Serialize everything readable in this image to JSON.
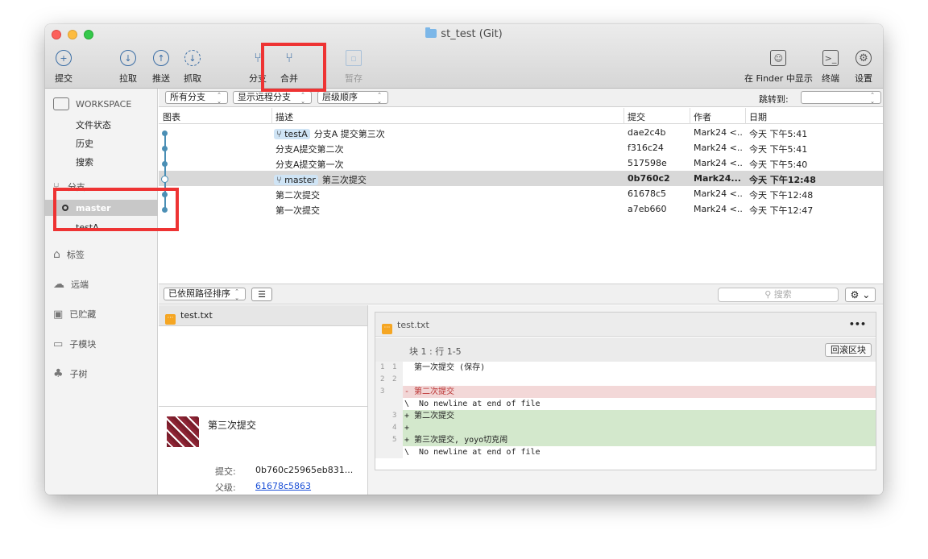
{
  "window": {
    "title": "st_test (Git)"
  },
  "toolbar": {
    "commit": "提交",
    "pull": "拉取",
    "push": "推送",
    "fetch": "抓取",
    "branch": "分支",
    "merge": "合并",
    "stash": "暂存",
    "show_in_finder": "在 Finder 中显示",
    "terminal": "终端",
    "settings": "设置"
  },
  "sidebar": {
    "workspace_title": "WORKSPACE",
    "workspace_items": [
      "文件状态",
      "历史",
      "搜索"
    ],
    "branches_title": "分支",
    "branches": [
      "master",
      "testA"
    ],
    "tags_title": "标签",
    "remotes_title": "远端",
    "stashes_title": "已贮藏",
    "submodules_title": "子模块",
    "subtrees_title": "子树"
  },
  "filterbar": {
    "branch_filter": "所有分支",
    "remote_filter": "显示远程分支",
    "order": "层级顺序",
    "jump_label": "跳转到:"
  },
  "columns": {
    "graph": "图表",
    "description": "描述",
    "commit": "提交",
    "author": "作者",
    "date": "日期"
  },
  "commits": [
    {
      "tag": "testA",
      "desc": "分支A 提交第三次",
      "hash": "dae2c4b",
      "author": "Mark24 <...",
      "date": "今天 下午5:41"
    },
    {
      "tag": "",
      "desc": "分支A提交第二次",
      "hash": "f316c24",
      "author": "Mark24 <...",
      "date": "今天 下午5:41"
    },
    {
      "tag": "",
      "desc": "分支A提交第一次",
      "hash": "517598e",
      "author": "Mark24 <...",
      "date": "今天 下午5:40"
    },
    {
      "tag": "master",
      "desc": "第三次提交",
      "hash": "0b760c2",
      "author": "Mark24...",
      "date": "今天 下午12:48"
    },
    {
      "tag": "",
      "desc": "第二次提交",
      "hash": "61678c5",
      "author": "Mark24 <...",
      "date": "今天 下午12:48"
    },
    {
      "tag": "",
      "desc": "第一次提交",
      "hash": "a7eb660",
      "author": "Mark24 <...",
      "date": "今天 下午12:47"
    }
  ],
  "lower": {
    "sort": "已依照路径排序",
    "search_placeholder": "搜索",
    "file": "test.txt"
  },
  "commit_info": {
    "message": "第三次提交",
    "commit_label": "提交:",
    "commit_value": "0b760c25965eb831...",
    "parent_label": "父级:",
    "parent_value": "61678c5863"
  },
  "diff": {
    "file": "test.txt",
    "more": "•••",
    "hunk": "块 1 :  行 1-5",
    "revert": "回滚区块",
    "lines": [
      {
        "type": "ctx",
        "old": "1",
        "new": "1",
        "text": "  第一次提交 (保存)"
      },
      {
        "type": "ctx",
        "old": "2",
        "new": "2",
        "text": ""
      },
      {
        "type": "del",
        "old": "3",
        "new": "",
        "text": "- 第二次提交"
      },
      {
        "type": "ctx",
        "old": "",
        "new": "",
        "text": "\\  No newline at end of file"
      },
      {
        "type": "add",
        "old": "",
        "new": "3",
        "text": "+ 第二次提交"
      },
      {
        "type": "add",
        "old": "",
        "new": "4",
        "text": "+"
      },
      {
        "type": "add",
        "old": "",
        "new": "5",
        "text": "+ 第三次提交, yoyo切克闹"
      },
      {
        "type": "ctx",
        "old": "",
        "new": "",
        "text": "\\  No newline at end of file"
      }
    ]
  },
  "colors": {
    "highlight": "#ee3333",
    "graph": "#4b8fb5",
    "tag_bg": "#cfe4f5"
  }
}
